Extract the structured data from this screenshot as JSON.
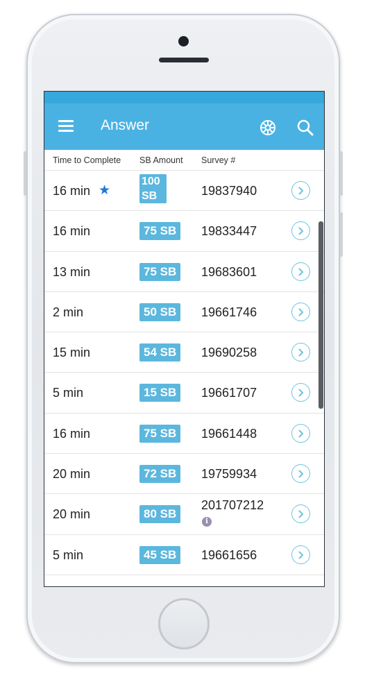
{
  "appbar": {
    "title": "Answer",
    "menu_icon": "menu-icon",
    "wheel_icon": "wheel-icon",
    "search_icon": "search-icon"
  },
  "columns": {
    "time": "Time to Complete",
    "sb": "SB Amount",
    "survey": "Survey #"
  },
  "colors": {
    "appbar": "#4ab2e3",
    "badge": "#5bb7dd",
    "chevron": "#6cc4dd",
    "star": "#1e78d6"
  },
  "rows": [
    {
      "time": "16 min",
      "starred": true,
      "sb_line1": "100",
      "sb_line2": "SB",
      "survey": "19837940"
    },
    {
      "time": "16 min",
      "sb": "75 SB",
      "survey": "19833447"
    },
    {
      "time": "13 min",
      "sb": "75 SB",
      "survey": "19683601"
    },
    {
      "time": "2 min",
      "sb": "50 SB",
      "survey": "19661746"
    },
    {
      "time": "15 min",
      "sb": "54 SB",
      "survey": "19690258"
    },
    {
      "time": "5 min",
      "sb": "15 SB",
      "survey": "19661707"
    },
    {
      "time": "16 min",
      "sb": "75 SB",
      "survey": "19661448"
    },
    {
      "time": "20 min",
      "sb": "72 SB",
      "survey": "19759934"
    },
    {
      "time": "20 min",
      "sb": "80 SB",
      "survey": "201707212",
      "info": true
    },
    {
      "time": "5 min",
      "sb": "45 SB",
      "survey": "19661656"
    }
  ]
}
